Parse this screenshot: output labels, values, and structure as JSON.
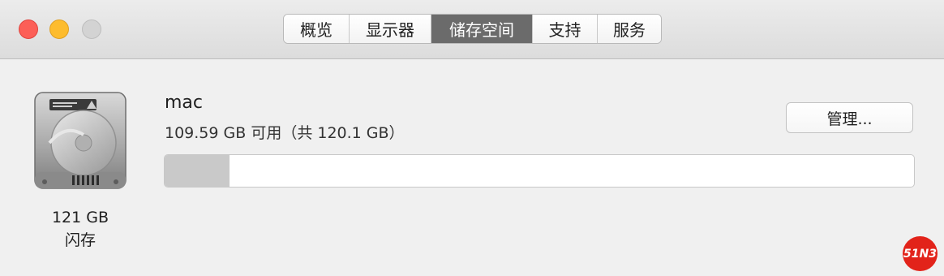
{
  "window": {
    "tabs": [
      {
        "label": "概览",
        "active": false
      },
      {
        "label": "显示器",
        "active": false
      },
      {
        "label": "储存空间",
        "active": true
      },
      {
        "label": "支持",
        "active": false
      },
      {
        "label": "服务",
        "active": false
      }
    ]
  },
  "disk": {
    "icon": "hard-drive-icon",
    "capacity": "121 GB",
    "type": "闪存"
  },
  "volume": {
    "name": "mac",
    "availability": "109.59 GB 可用（共 120.1 GB）",
    "used_fraction": 0.087
  },
  "actions": {
    "manage_label": "管理..."
  },
  "watermark": {
    "text": "51N3"
  },
  "colors": {
    "close": "#fc5f57",
    "minimize": "#fdbc2e",
    "zoom": "#d3d3d3",
    "active_tab": "#6b6b6b",
    "usage_fill": "#c9c9c9",
    "watermark": "#e2231a"
  }
}
